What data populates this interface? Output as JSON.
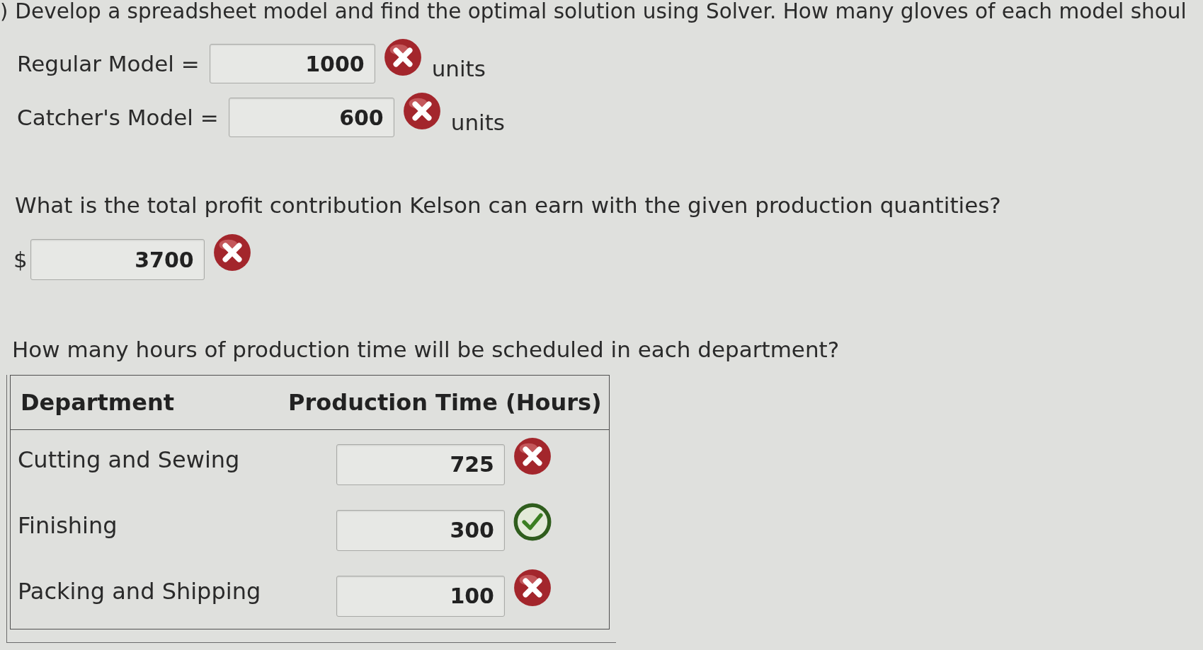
{
  "part_marker": ")",
  "intro": "Develop a spreadsheet model and find the optimal solution using Solver. How many gloves of each model shoul",
  "quantities": [
    {
      "label": "Regular Model =",
      "value": "1000",
      "correct": false,
      "unit": "units"
    },
    {
      "label": "Catcher's Model =",
      "value": "600",
      "correct": false,
      "unit": "units"
    }
  ],
  "profit": {
    "question": "What is the total profit contribution Kelson can earn with the given production quantities?",
    "currency": "$",
    "value": "3700",
    "correct": false
  },
  "hours": {
    "question": "How many hours of production time will be scheduled in each department?",
    "columns": [
      "Department",
      "Production Time (Hours)"
    ],
    "rows": [
      {
        "department": "Cutting and Sewing",
        "value": "725",
        "correct": false
      },
      {
        "department": "Finishing",
        "value": "300",
        "correct": true
      },
      {
        "department": "Packing and Shipping",
        "value": "100",
        "correct": false
      }
    ]
  }
}
